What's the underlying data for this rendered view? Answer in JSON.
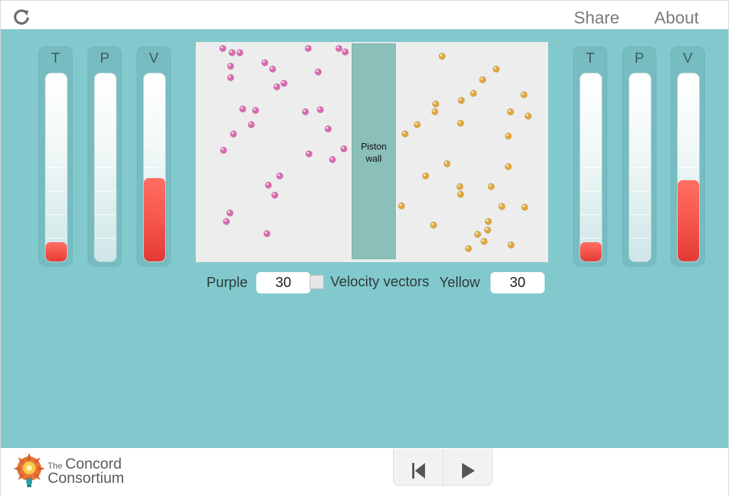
{
  "header": {
    "share_label": "Share",
    "about_label": "About",
    "reload_icon": "reload-icon"
  },
  "left_gauges": [
    {
      "label": "T",
      "level": 0.1
    },
    {
      "label": "P",
      "level": 0.0
    },
    {
      "label": "V",
      "level": 0.44
    }
  ],
  "right_gauges": [
    {
      "label": "T",
      "level": 0.1
    },
    {
      "label": "P",
      "level": 0.0
    },
    {
      "label": "V",
      "level": 0.43
    }
  ],
  "simulation": {
    "piston_label": "Piston\nwall",
    "purple_color": "#d96bb0",
    "yellow_color": "#e0a83a"
  },
  "controls": {
    "purple_label": "Purple",
    "purple_count": "30",
    "velocity_label": "Velocity vectors",
    "velocity_checked": false,
    "yellow_label": "Yellow",
    "yellow_count": "30"
  },
  "footer": {
    "logo_the": "The",
    "logo_line1": "Concord",
    "logo_line2": "Consortium",
    "reset_icon": "skip-to-start-icon",
    "play_icon": "play-icon"
  },
  "colors": {
    "background": "#82c9cd",
    "gauge_fill": "#f4544a",
    "piston": "#8abfba"
  }
}
